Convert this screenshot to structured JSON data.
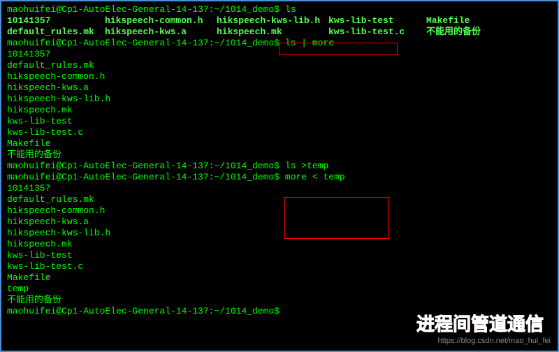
{
  "prompt_path": "maohuifei@Cp1-AutoElec-General-14-137:~/1014_demo$",
  "commands": {
    "ls": "ls",
    "ls_more": "ls | more",
    "ls_temp": "ls >temp",
    "more_temp": "more < temp"
  },
  "ls_table": {
    "row1": [
      "10141357",
      "hikspeech-common.h",
      "hikspeech-kws-lib.h",
      "kws-lib-test",
      "Makefile"
    ],
    "row2": [
      "default_rules.mk",
      "hikspeech-kws.a",
      "hikspeech.mk",
      "kws-lib-test.c",
      "不能用的备份"
    ]
  },
  "listing1": [
    "10141357",
    "default_rules.mk",
    "hikspeech-common.h",
    "hikspeech-kws.a",
    "hikspeech-kws-lib.h",
    "hikspeech.mk",
    "kws-lib-test",
    "kws-lib-test.c",
    "Makefile",
    "不能用的备份"
  ],
  "listing2": [
    "10141357",
    "default_rules.mk",
    "hikspeech-common.h",
    "hikspeech-kws.a",
    "hikspeech-kws-lib.h",
    "hikspeech.mk",
    "kws-lib-test",
    "kws-lib-test.c",
    "Makefile",
    "temp",
    "不能用的备份"
  ],
  "annotation_text": "进程间管道通信",
  "watermark_text": "https://blog.csdn.net/mao_hui_fei"
}
